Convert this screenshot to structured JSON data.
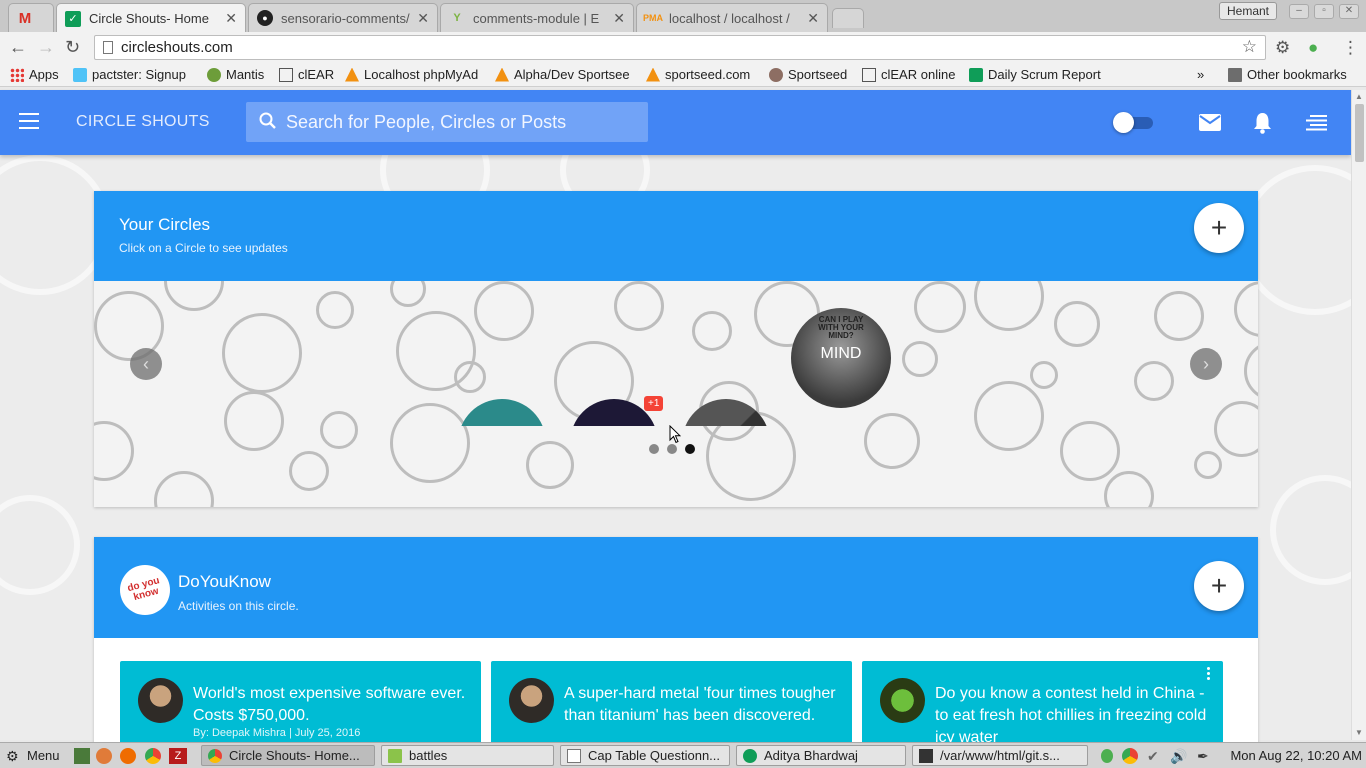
{
  "browser": {
    "tabs": [
      {
        "title": "",
        "icon": "gmail-icon"
      },
      {
        "title": "Circle Shouts- Home",
        "icon": "check-icon",
        "active": true
      },
      {
        "title": "sensorario-comments/",
        "icon": "github-icon"
      },
      {
        "title": "comments-module | E",
        "icon": "yii-icon"
      },
      {
        "title": "localhost / localhost / ",
        "icon": "pma-icon"
      }
    ],
    "profile": "Hemant",
    "url": "circleshouts.com",
    "bookmarks": [
      "Apps",
      "pactster: Signup",
      "Mantis",
      "clEAR",
      "Localhost phpMyAd",
      "Alpha/Dev Sportsee",
      "sportseed.com",
      "Sportseed",
      "clEAR online",
      "Daily Scrum Report"
    ],
    "bookmarks_overflow": "»",
    "other_bookmarks": "Other bookmarks"
  },
  "app": {
    "brand": "CIRCLE SHOUTS",
    "search_placeholder": "Search for People, Circles or Posts",
    "accent": "#4285f4"
  },
  "circles_card": {
    "title": "Your Circles",
    "subtitle": "Click on a Circle to see updates",
    "add_label": "+",
    "featured_label": "MIND",
    "featured_caption": "CAN I PLAY WITH YOUR MIND?",
    "badge": "+1",
    "prev": "‹",
    "next": "›",
    "page_count": 3,
    "active_page": 3
  },
  "circle_feed": {
    "title": "DoYouKnow",
    "subtitle": "Activities on this circle.",
    "add_label": "+",
    "logo_text": "do you know",
    "posts": [
      {
        "text": "World's most expensive software ever. Costs $750,000.",
        "byline": "By: Deepak Mishra | July 25, 2016"
      },
      {
        "text": "A super-hard metal 'four times tougher than titanium' has been discovered."
      },
      {
        "text": "Do you know a contest held in China - to eat fresh hot chillies in freezing cold icy water"
      }
    ]
  },
  "taskbar": {
    "menu": "Menu",
    "windows": [
      "Circle Shouts- Home...",
      "battles",
      "Cap Table Questionn...",
      "Aditya Bhardwaj",
      "/var/www/html/git.s..."
    ],
    "clock": "Mon Aug 22, 10:20 AM"
  }
}
